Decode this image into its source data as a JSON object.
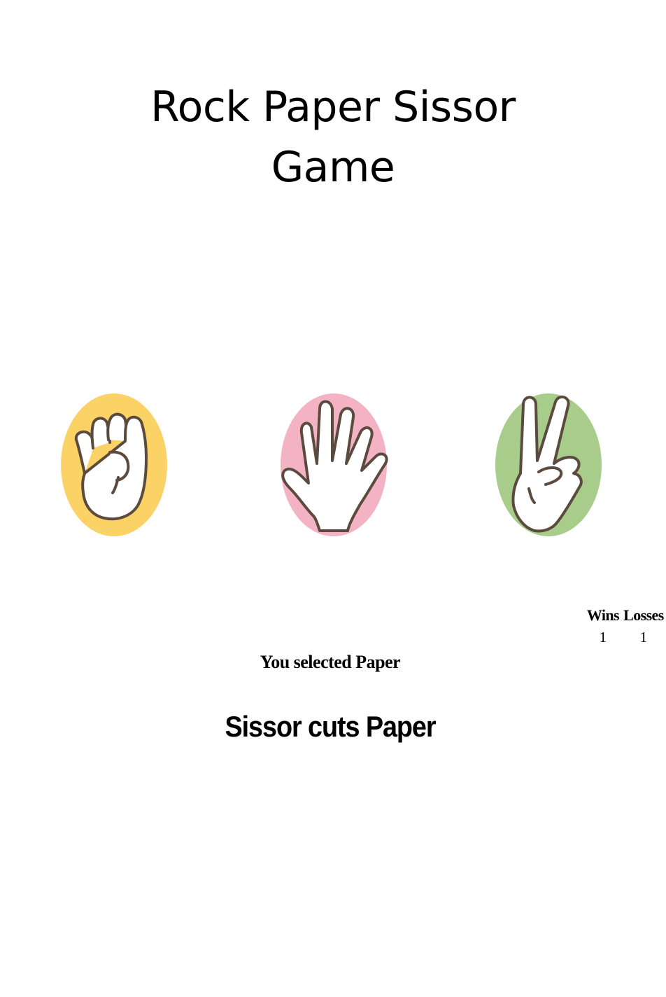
{
  "page": {
    "title_line1": "Rock Paper Sissor",
    "title_line2": "Game"
  },
  "choices": [
    {
      "name": "Rock",
      "icon": "fist-hand-icon",
      "bg_color": "#fbd265"
    },
    {
      "name": "Paper",
      "icon": "open-hand-icon",
      "bg_color": "#f4b3c4"
    },
    {
      "name": "Sissor",
      "icon": "peace-sign-hand-icon",
      "bg_color": "#a8cd8b"
    }
  ],
  "scoreboard": {
    "wins_label": "Wins",
    "losses_label": "Losses",
    "wins": "1",
    "losses": "1"
  },
  "status": {
    "selected_text": "You selected Paper",
    "result_text": "Sissor cuts Paper"
  }
}
